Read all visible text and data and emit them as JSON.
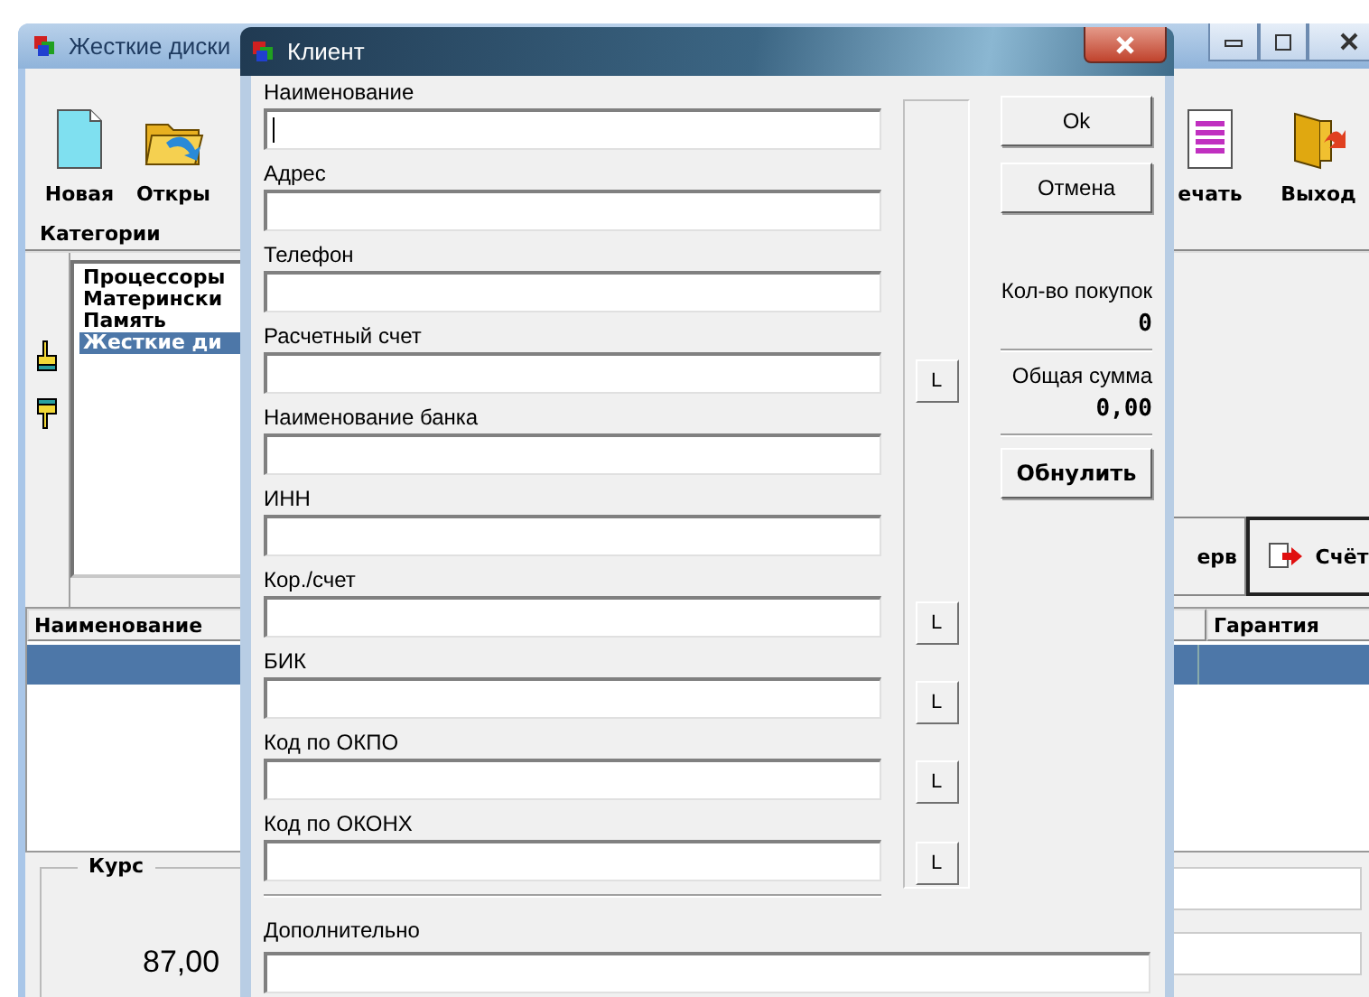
{
  "main_window": {
    "title": "Жесткие диски",
    "toolbar_left": [
      {
        "label": "Новая",
        "kind": "new"
      },
      {
        "label": "Откры",
        "kind": "open"
      }
    ],
    "toolbar_right": [
      {
        "label": "ечать",
        "kind": "print"
      },
      {
        "label": "Выход",
        "kind": "exit"
      }
    ],
    "categories_label": "Категории",
    "categories": [
      {
        "label": "Процессоры",
        "selected": false
      },
      {
        "label": "Матерински",
        "selected": false
      },
      {
        "label": "Память",
        "selected": false
      },
      {
        "label": "Жесткие ди",
        "selected": true
      }
    ],
    "action_buttons": [
      {
        "label": "ерв",
        "kind": "plain"
      },
      {
        "label": "Счёт",
        "kind": "invoice"
      }
    ],
    "table": {
      "columns": [
        {
          "label": "Наименование"
        },
        {
          "label": "Гарантия"
        }
      ],
      "rows": [
        {
          "selected": true
        }
      ]
    },
    "rate": {
      "label": "Курс",
      "value": "87,00"
    }
  },
  "dialog": {
    "title": "Клиент",
    "fields": [
      {
        "label": "Наименование",
        "focused": true
      },
      {
        "label": "Адрес",
        "focused": false
      },
      {
        "label": "Телефон",
        "focused": false
      },
      {
        "label": "Расчетный счет",
        "lookup_button": "L",
        "focused": false
      },
      {
        "label": "Наименование банка",
        "focused": false
      },
      {
        "label": "ИНН",
        "focused": false
      },
      {
        "label": "Кор./счет",
        "lookup_button": "L",
        "focused": false
      },
      {
        "label": "БИК",
        "lookup_button": "L",
        "focused": false
      },
      {
        "label": "Код по ОКПО",
        "lookup_button": "L",
        "focused": false
      },
      {
        "label": "Код по ОКОНХ",
        "lookup_button": "L",
        "focused": false
      }
    ],
    "buttons": [
      {
        "label": "Ok"
      },
      {
        "label": "Отмена"
      }
    ],
    "stats": [
      {
        "label": "Кол-во покупок",
        "value": "0"
      },
      {
        "label": "Общая сумма",
        "value": "0,00"
      }
    ],
    "reset_button": "Обнулить",
    "extra_field": {
      "label": "Дополнительно"
    }
  }
}
